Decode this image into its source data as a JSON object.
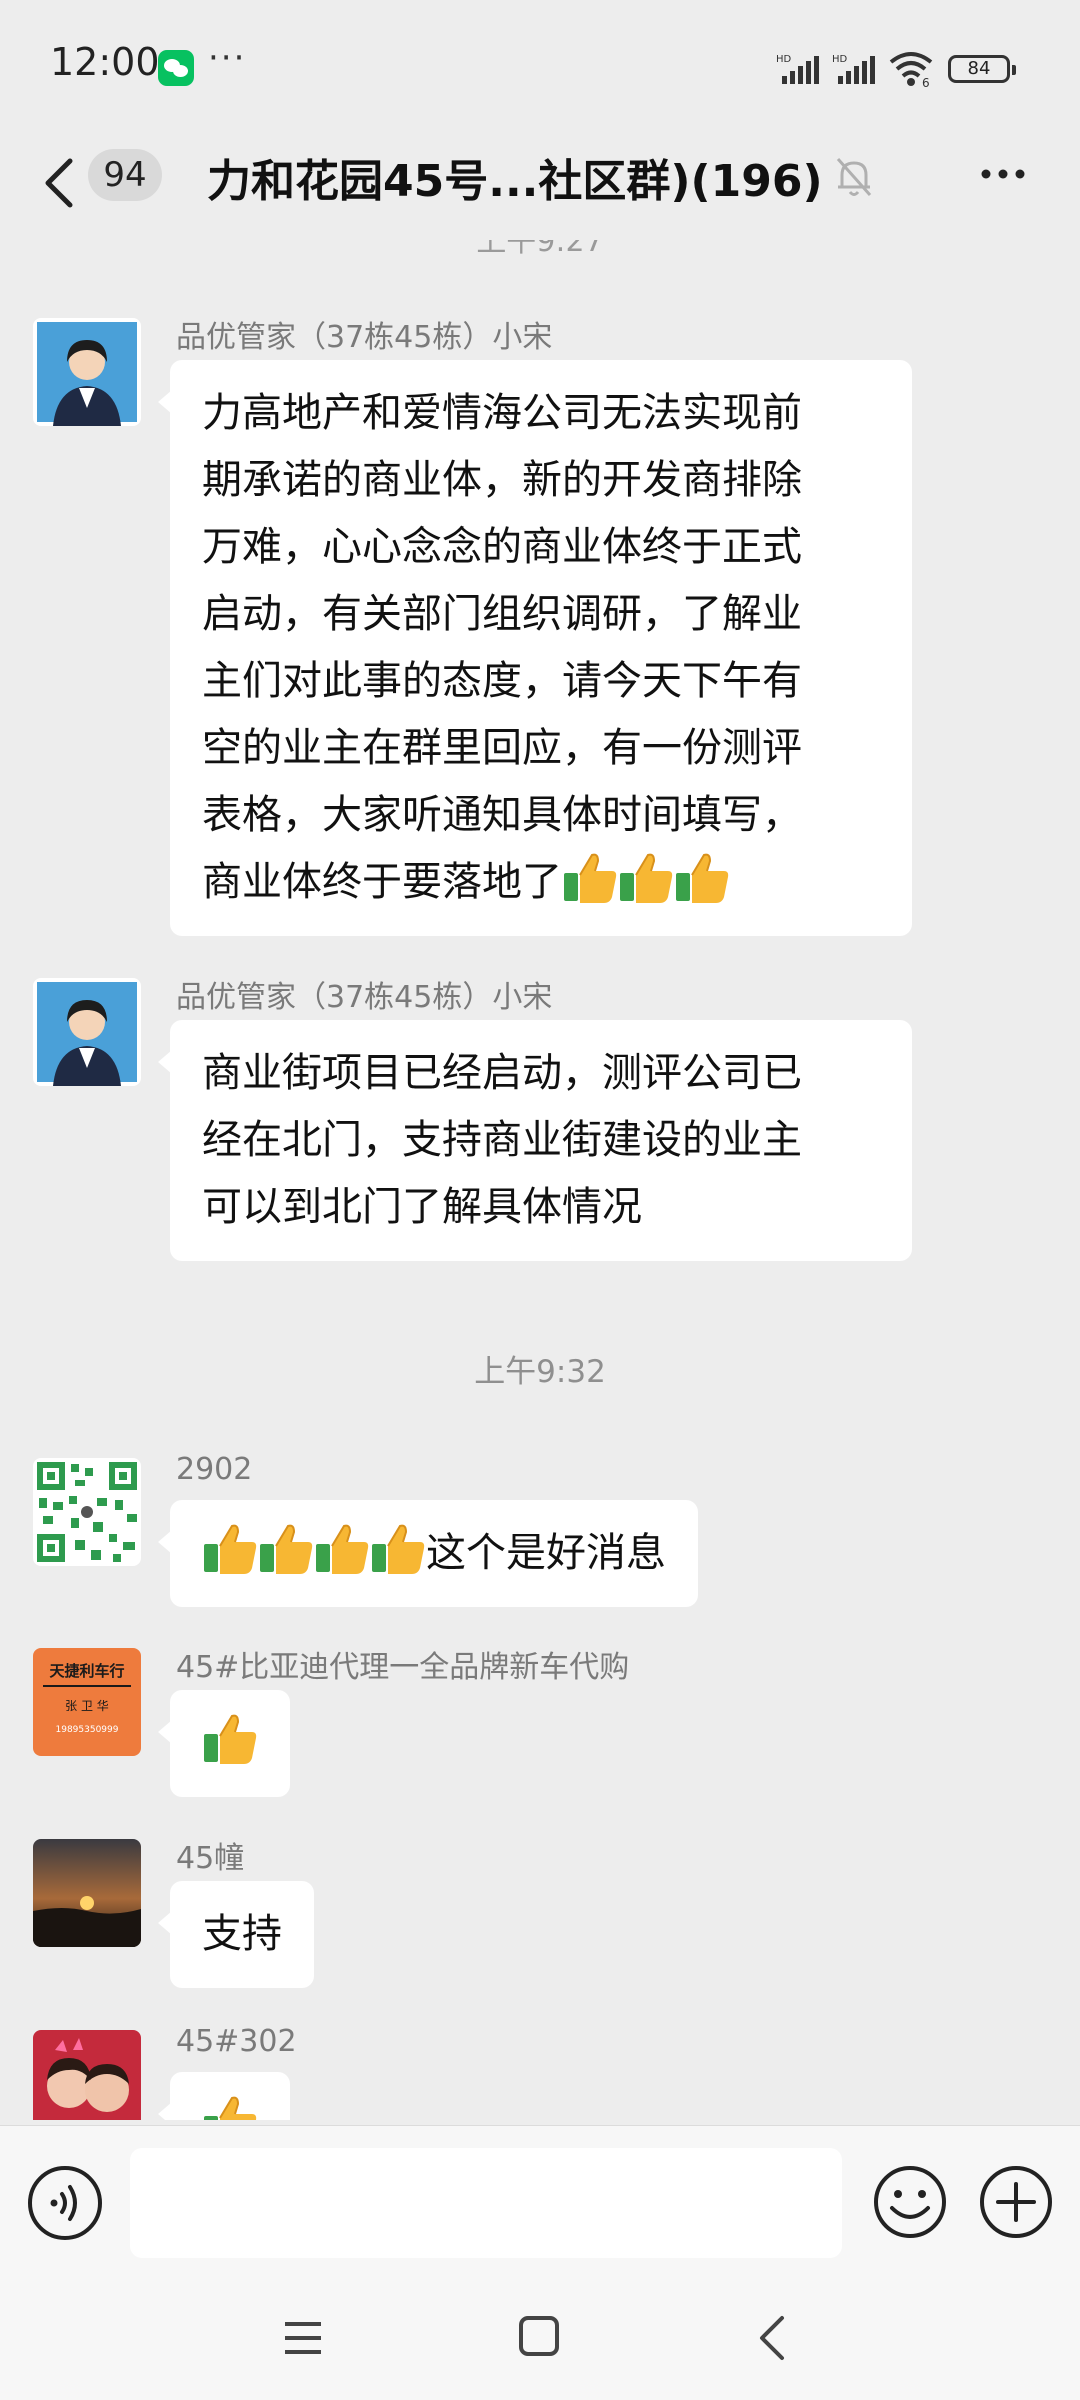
{
  "status_bar": {
    "time": "12:00",
    "signal_label_1": "HD",
    "signal_label_2": "HD",
    "battery": "84",
    "icons": [
      "wechat-notification-icon",
      "more-dots-icon",
      "signal-icon",
      "wifi-icon",
      "battery-icon"
    ]
  },
  "header": {
    "unread_count": "94",
    "title": "力和花园45号...社区群)(196)",
    "icons": [
      "back-icon",
      "mute-icon",
      "more-icon"
    ]
  },
  "messages": [
    {
      "sender": "品优管家（37栋45栋）小宋",
      "lines": [
        "力高地产和爱情海公司无法实现前",
        "期承诺的商业体，新的开发商排除",
        "万难，心心念念的商业体终于正式",
        "启动，有关部门组织调研，了解业",
        "主们对此事的态度，请今天下午有",
        "空的业主在群里回应，有一份测评",
        "表格，大家听通知具体时间填写，",
        "商业体终于要落地了"
      ],
      "emoji_count": 3
    },
    {
      "sender": "品优管家（37栋45栋）小宋",
      "lines": [
        "商业街项目已经启动，测评公司已",
        "经在北门，支持商业街建设的业主",
        "可以到北门了解具体情况"
      ]
    },
    {
      "sender": "2902",
      "text": "这个是好消息",
      "emoji_count": 4
    },
    {
      "sender": "45#比亚迪代理一全品牌新车代购",
      "avatar_text": [
        "天捷利车行",
        "张 卫 华",
        "19895350999"
      ],
      "emoji_count": 1
    },
    {
      "sender": "45幢",
      "text": "支持"
    },
    {
      "sender": "45#302",
      "emoji_count": 1
    }
  ],
  "time_separator": "上午9:32",
  "colors": {
    "background": "#ededed",
    "bubble": "#ffffff",
    "wechat_green": "#07c160",
    "meta_text": "#7a7a7a"
  },
  "input_bar": {
    "value": "",
    "icons": [
      "voice-icon",
      "emoji-icon",
      "plus-icon"
    ]
  },
  "system_nav": {
    "icons": [
      "menu-icon",
      "home-icon",
      "back-icon"
    ]
  }
}
